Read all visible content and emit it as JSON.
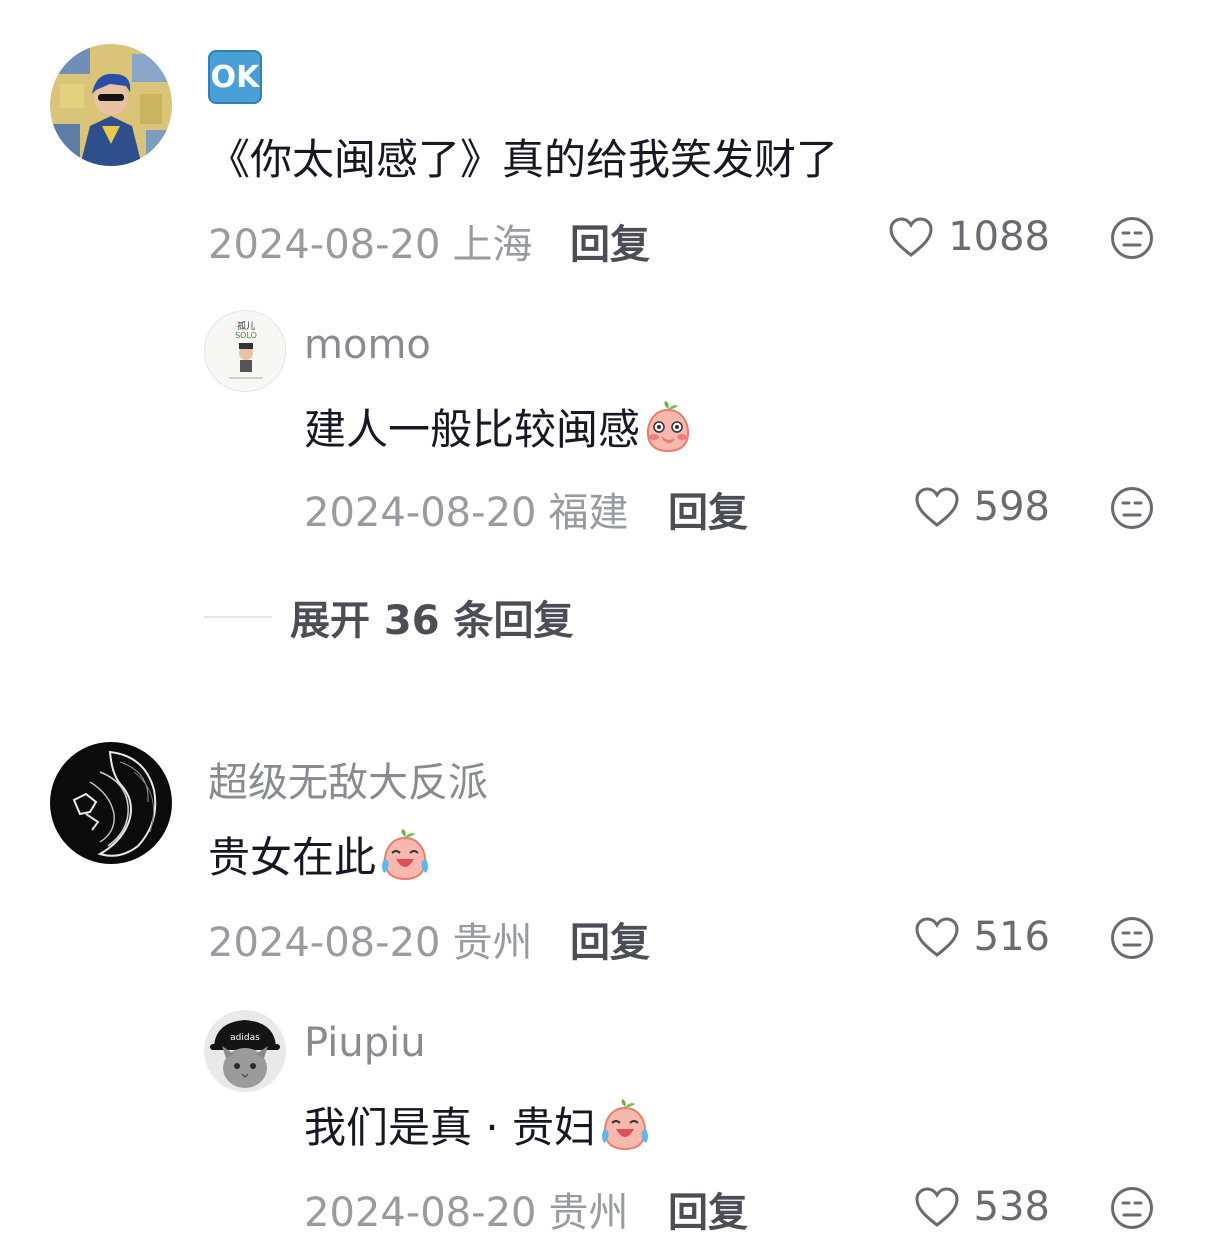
{
  "comments": [
    {
      "username_badge": "OK",
      "text": "《你太闽感了》真的给我笑发财了",
      "date": "2024-08-20",
      "location": "上海",
      "reply_label": "回复",
      "likes": "1088",
      "replies": [
        {
          "username": "momo",
          "text": "建人一般比较闽感",
          "emoji": "shy-peach-emoji",
          "date": "2024-08-20",
          "location": "福建",
          "reply_label": "回复",
          "likes": "598"
        }
      ],
      "expand_label": "展开 36 条回复"
    },
    {
      "username": "超级无敌大反派",
      "text": "贵女在此",
      "emoji": "crying-laughing-peach-emoji",
      "date": "2024-08-20",
      "location": "贵州",
      "reply_label": "回复",
      "likes": "516",
      "replies": [
        {
          "username": "Piupiu",
          "text": "我们是真 · 贵妇",
          "emoji": "crying-laughing-peach-emoji",
          "date": "2024-08-20",
          "location": "贵州",
          "reply_label": "回复",
          "likes": "538"
        }
      ]
    }
  ],
  "icons": {
    "like": "heart-outline-icon",
    "dislike": "neutral-face-icon"
  },
  "colors": {
    "text": "#161823",
    "meta": "#9a9ba0",
    "username": "#8a8b91",
    "reply": "#4d4e55"
  }
}
